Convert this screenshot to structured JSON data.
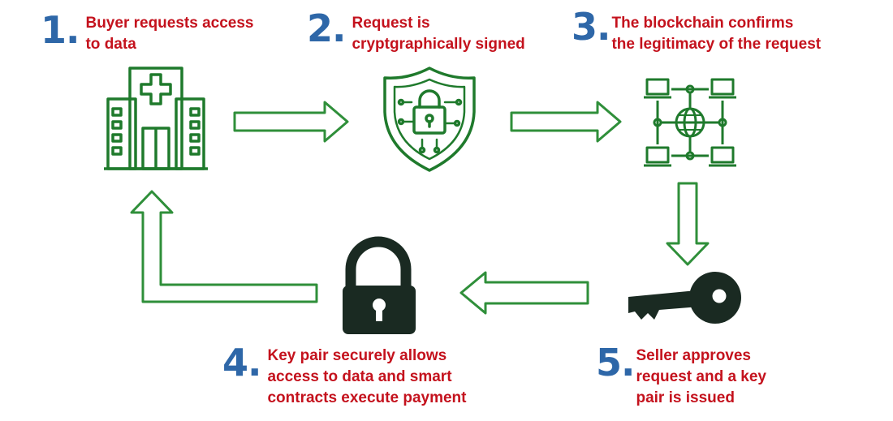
{
  "colors": {
    "step_number": "#2e67a8",
    "step_text": "#c4121d",
    "icon_green": "#1f7a2c",
    "arrow_outline": "#2f8f3a",
    "dark_icon": "#1a2a22"
  },
  "steps": [
    {
      "number": "1.",
      "text": "Buyer requests access\nto data",
      "icon": "hospital-icon"
    },
    {
      "number": "2.",
      "text": "Request is\ncryptgraphically signed",
      "icon": "shield-lock-icon"
    },
    {
      "number": "3.",
      "text": "The blockchain confirms\nthe legitimacy of the request",
      "icon": "network-globe-icon"
    },
    {
      "number": "4.",
      "text": "Key pair securely allows\naccess to data and smart\ncontracts execute payment",
      "icon": "padlock-icon"
    },
    {
      "number": "5.",
      "text": "Seller approves\nrequest and a key\npair is issued",
      "icon": "key-icon"
    }
  ]
}
